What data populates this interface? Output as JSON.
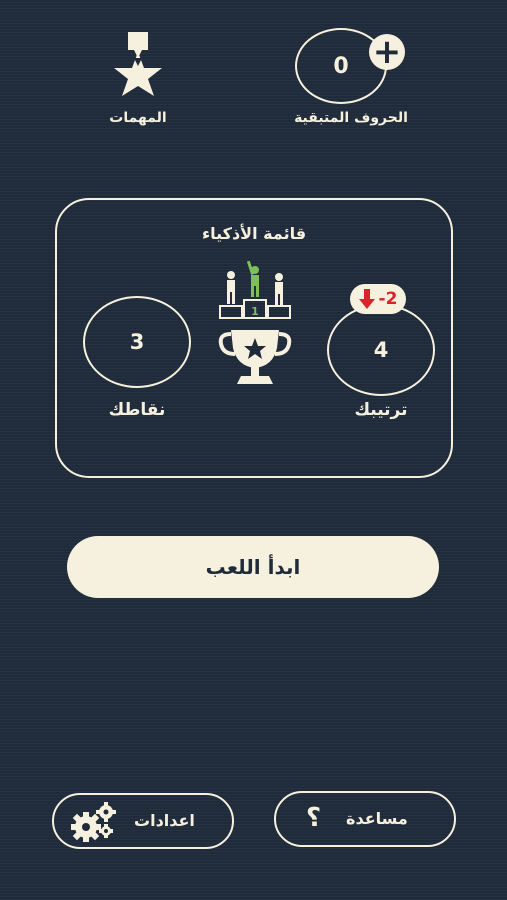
{
  "top": {
    "remaining_letters": {
      "count": "0",
      "label": "الحروف المتبقية",
      "add_icon": "plus-icon"
    },
    "missions": {
      "label": "المهمات",
      "icon": "star-badge-icon"
    }
  },
  "leaderboard": {
    "title": "قائمة الأذكياء",
    "points": {
      "value": "3",
      "label": "نقاطك"
    },
    "rank": {
      "value": "4",
      "label": "ترتيبك",
      "change": "-2",
      "change_icon": "arrow-down-icon"
    },
    "trophy_icon": "trophy-podium-icon",
    "podium_first_place": "1"
  },
  "start_button": {
    "label": "ابدأ اللعب"
  },
  "bottom": {
    "settings": {
      "label": "اعدادات",
      "icon": "gears-icon"
    },
    "help": {
      "label": "مساعدة",
      "icon": "question-mark-icon",
      "glyph": "؟"
    }
  },
  "colors": {
    "background": "#1f2a3a",
    "cream": "#f6f0de",
    "accent_green": "#7fbf5a",
    "alert_red": "#d8242a"
  }
}
